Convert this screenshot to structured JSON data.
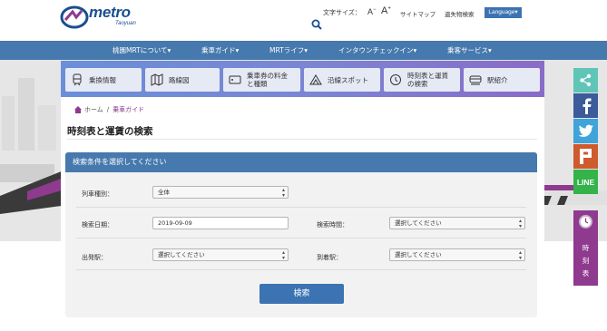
{
  "header": {
    "logo_text": "metro",
    "logo_sub": "Taoyuan",
    "font_size_label": "文字サイズ：",
    "font_small": "A",
    "font_small_sup": "−",
    "font_large": "A",
    "font_large_sup": "+",
    "sitemap": "サイトマップ",
    "lost_items": "遺失物検索",
    "language": "Language▾",
    "colors": {
      "logo": "#1b4f8f",
      "language_bg": "#3c73b2"
    }
  },
  "nav": {
    "items": [
      "桃園MRTについて▾",
      "乗車ガイド▾",
      "MRTライフ▾",
      "インタウンチェックイン▾",
      "乗客サービス▾"
    ],
    "color": "#4679ad"
  },
  "quick_menu": {
    "items": [
      {
        "label": "乗換情報",
        "icon": "train-icon"
      },
      {
        "label": "路線図",
        "icon": "map-icon"
      },
      {
        "label": "乗車券の料金と種類",
        "icon": "ticket-icon"
      },
      {
        "label": "沿線スポット",
        "icon": "mountain-icon"
      },
      {
        "label": "時刻表と運賃の検索",
        "icon": "clock-icon"
      },
      {
        "label": "駅紹介",
        "icon": "station-train-icon"
      }
    ]
  },
  "breadcrumb": {
    "home": "ホーム",
    "separator": "/",
    "current": "乗車ガイド"
  },
  "page": {
    "title": "時刻表と運賃の検索"
  },
  "form": {
    "header": "検索条件を選択してください",
    "train_type_label": "列車種別：",
    "train_type_value": "全体",
    "date_label": "検索日期：",
    "date_value": "2019-09-09",
    "time_label": "検索時間：",
    "time_value": "選択してください",
    "departure_label": "出発駅：",
    "departure_value": "選択してください",
    "arrival_label": "到着駅：",
    "arrival_value": "選択してください",
    "submit": "検索"
  },
  "social": {
    "line": "LINE",
    "timetable": [
      "時",
      "刻",
      "表"
    ],
    "colors": {
      "share": "#5ec5b7",
      "facebook": "#3b5b9a",
      "twitter": "#40a3d9",
      "plurk": "#cf5a2c",
      "line": "#33b34a",
      "timetable": "#8f3a8f"
    }
  }
}
